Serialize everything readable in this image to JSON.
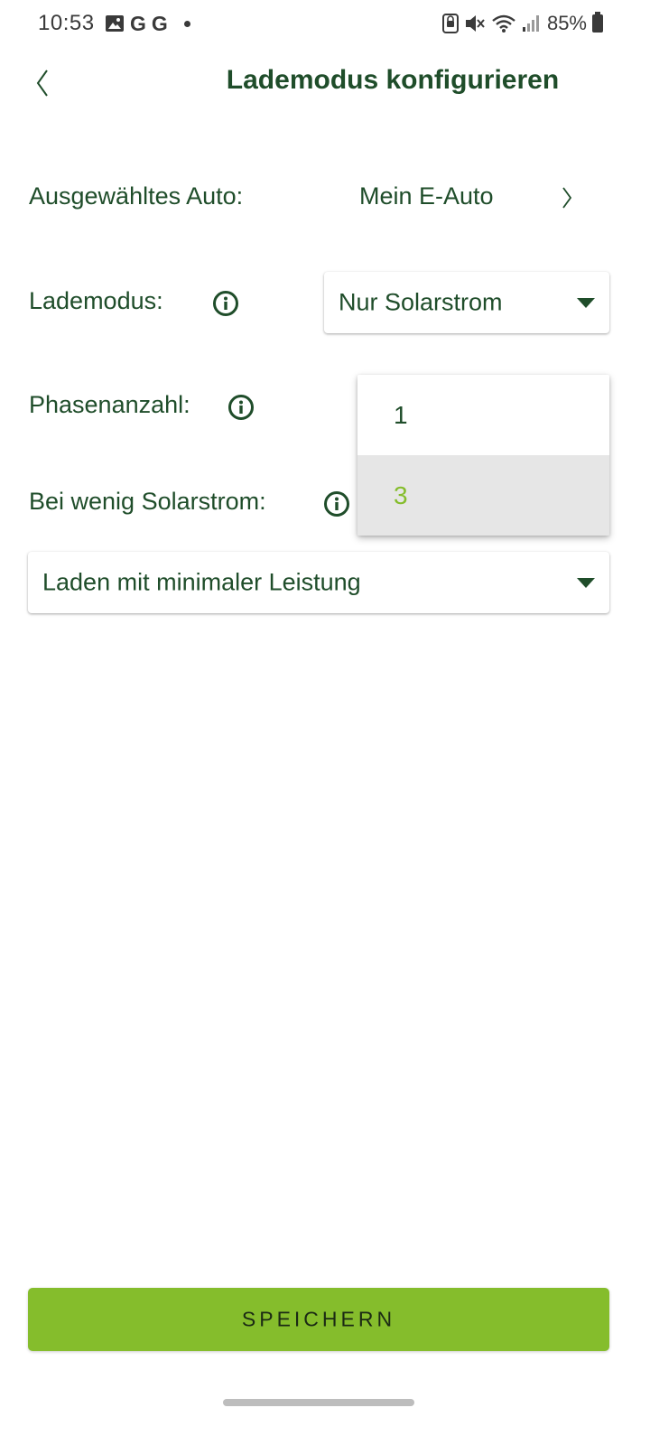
{
  "status_bar": {
    "time": "10:53",
    "left_icons": [
      "gallery-icon",
      "google-icon",
      "google-icon",
      "notification-dot-icon"
    ],
    "google_glyph": "G",
    "battery": "85%",
    "right_icons": [
      "nfc-icon",
      "mute-icon",
      "wifi-icon",
      "signal-icon",
      "battery-icon"
    ]
  },
  "header": {
    "title": "Lademodus konfigurieren",
    "back_icon": "chevron-left-icon"
  },
  "form": {
    "selected_car": {
      "label": "Ausgewähltes Auto:",
      "value": "Mein E-Auto",
      "icon": "chevron-right-icon"
    },
    "charge_mode": {
      "label": "Lademodus:",
      "value": "Nur Solarstrom",
      "info_icon": "info-icon"
    },
    "phases": {
      "label": "Phasenanzahl:",
      "info_icon": "info-icon"
    },
    "low_solar": {
      "label": "Bei wenig Solarstrom:",
      "value": "Laden mit minimaler Leistung",
      "info_icon": "info-icon"
    }
  },
  "dropdown": {
    "options": [
      "1",
      "3"
    ],
    "highlighted": "3"
  },
  "save_button": {
    "label": "SPEICHERN"
  },
  "colors": {
    "primary_text": "#1f4d2a",
    "accent": "#85bd2c",
    "highlight_bg": "#e6e6e6"
  }
}
